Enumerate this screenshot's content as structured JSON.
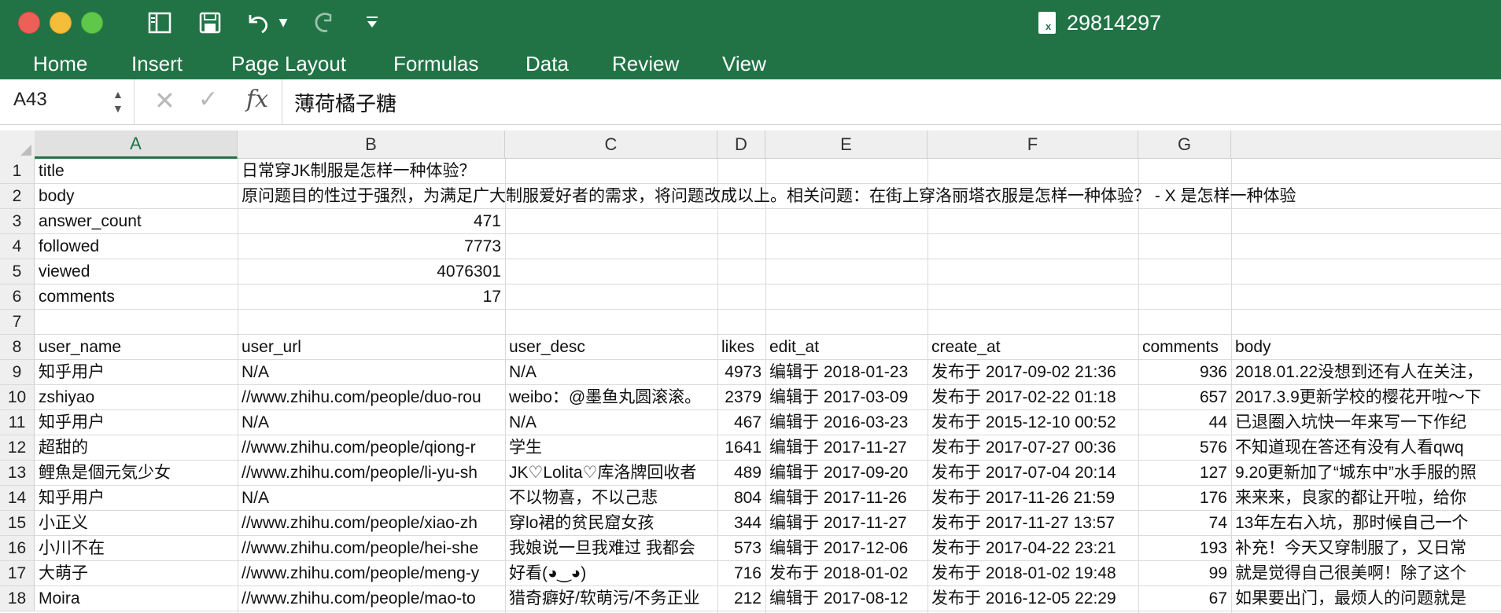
{
  "window": {
    "title": "29814297",
    "icons": [
      "close-button",
      "minimize-button",
      "maximize-button",
      "sidebar-icon",
      "save-icon",
      "undo-icon",
      "redo-icon",
      "customize-toolbar-icon",
      "excel-document-icon"
    ]
  },
  "ribbon": {
    "tabs": [
      "Home",
      "Insert",
      "Page Layout",
      "Formulas",
      "Data",
      "Review",
      "View"
    ]
  },
  "formula_bar": {
    "name_box": "A43",
    "fx_label": "fx",
    "value": "薄荷橘子糖"
  },
  "columns": [
    "A",
    "B",
    "C",
    "D",
    "E",
    "F",
    "G"
  ],
  "rows": [
    {
      "num": "1",
      "cells": [
        "title",
        "日常穿JK制服是怎样一种体验？",
        "",
        "",
        "",
        "",
        "",
        ""
      ]
    },
    {
      "num": "2",
      "cells": [
        "body",
        "原问题目的性过于强烈，为满足广大制服爱好者的需求，将问题改成以上。相关问题：在街上穿洛丽塔衣服是怎样一种体验？ - X 是怎样一种体验",
        "",
        "",
        "",
        "",
        "",
        ""
      ]
    },
    {
      "num": "3",
      "cells": [
        "answer_count",
        "471",
        "",
        "",
        "",
        "",
        "",
        ""
      ]
    },
    {
      "num": "4",
      "cells": [
        "followed",
        "7773",
        "",
        "",
        "",
        "",
        "",
        ""
      ]
    },
    {
      "num": "5",
      "cells": [
        "viewed",
        "4076301",
        "",
        "",
        "",
        "",
        "",
        ""
      ]
    },
    {
      "num": "6",
      "cells": [
        "comments",
        "17",
        "",
        "",
        "",
        "",
        "",
        ""
      ]
    },
    {
      "num": "7",
      "cells": [
        "",
        "",
        "",
        "",
        "",
        "",
        "",
        ""
      ]
    },
    {
      "num": "8",
      "cells": [
        "user_name",
        "user_url",
        "user_desc",
        "likes",
        "edit_at",
        "create_at",
        "comments",
        "body"
      ]
    },
    {
      "num": "9",
      "cells": [
        "知乎用户",
        "N/A",
        "N/A",
        "4973",
        "编辑于 2018-01-23",
        "发布于 2017-09-02 21:36",
        "936",
        "2018.01.22没想到还有人在关注，"
      ]
    },
    {
      "num": "10",
      "cells": [
        "zshiyao",
        "//www.zhihu.com/people/duo-rou",
        "weibo：@墨鱼丸圆滚滚。",
        "2379",
        "编辑于 2017-03-09",
        "发布于 2017-02-22 01:18",
        "657",
        "2017.3.9更新学校的樱花开啦～下"
      ]
    },
    {
      "num": "11",
      "cells": [
        "知乎用户",
        "N/A",
        "N/A",
        "467",
        "编辑于 2016-03-23",
        "发布于 2015-12-10 00:52",
        "44",
        "已退圈入坑快一年来写一下作纪"
      ]
    },
    {
      "num": "12",
      "cells": [
        "超甜的",
        "//www.zhihu.com/people/qiong-r",
        "学生",
        "1641",
        "编辑于 2017-11-27",
        "发布于 2017-07-27 00:36",
        "576",
        "不知道现在答还有没有人看qwq"
      ]
    },
    {
      "num": "13",
      "cells": [
        "鲤魚是個元気少女",
        "//www.zhihu.com/people/li-yu-sh",
        "JK♡Lolita♡库洛牌回收者",
        "489",
        "编辑于 2017-09-20",
        "发布于 2017-07-04 20:14",
        "127",
        "9.20更新加了“城东中”水手服的照"
      ]
    },
    {
      "num": "14",
      "cells": [
        "知乎用户",
        "N/A",
        "不以物喜，不以己悲",
        "804",
        "编辑于 2017-11-26",
        "发布于 2017-11-26 21:59",
        "176",
        "来来来，良家的都让开啦，给你"
      ]
    },
    {
      "num": "15",
      "cells": [
        "小正义",
        "//www.zhihu.com/people/xiao-zh",
        "穿lo裙的贫民窟女孩",
        "344",
        "编辑于 2017-11-27",
        "发布于 2017-11-27 13:57",
        "74",
        "13年左右入坑，那时候自己一个"
      ]
    },
    {
      "num": "16",
      "cells": [
        "小川不在",
        "//www.zhihu.com/people/hei-she",
        "我娘说一旦我难过 我都会",
        "573",
        "编辑于 2017-12-06",
        "发布于 2017-04-22 23:21",
        "193",
        "补充！今天又穿制服了，又日常"
      ]
    },
    {
      "num": "17",
      "cells": [
        "大萌子",
        "//www.zhihu.com/people/meng-y",
        "好看(◕‿◕)",
        "716",
        "发布于 2018-01-02",
        "发布于 2018-01-02 19:48",
        "99",
        "就是觉得自己很美啊！除了这个"
      ]
    },
    {
      "num": "18",
      "cells": [
        "Moira",
        "//www.zhihu.com/people/mao-to",
        "猎奇癖好/软萌污/不务正业",
        "212",
        "编辑于 2017-08-12",
        "发布于 2016-12-05 22:29",
        "67",
        "如果要出门，最烦人的问题就是"
      ]
    }
  ]
}
